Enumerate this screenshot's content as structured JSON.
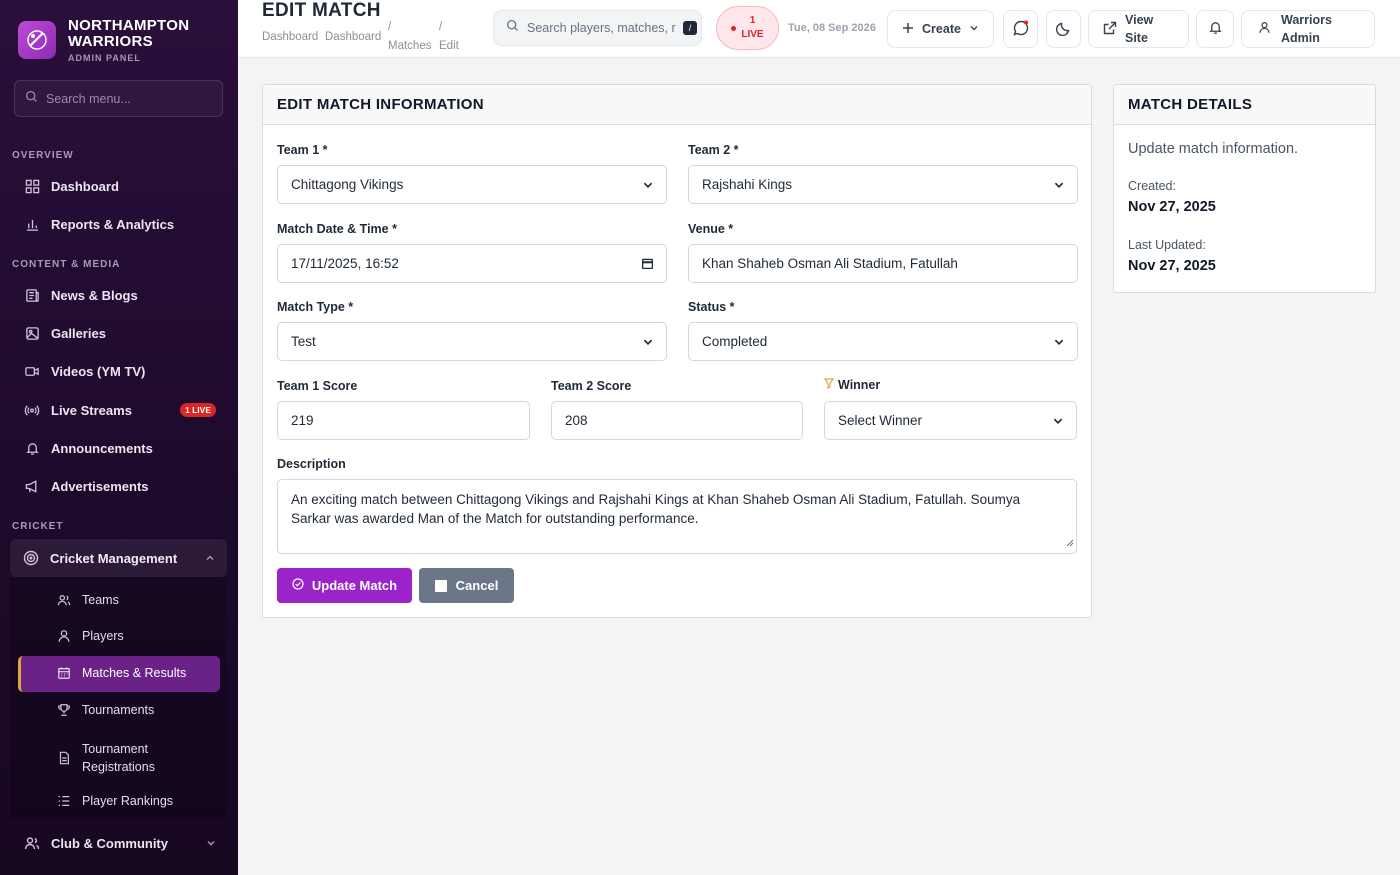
{
  "brand": {
    "name_line1": "NORTHAMPTON",
    "name_line2": "WARRIORS",
    "subtitle": "ADMIN PANEL"
  },
  "sidebar": {
    "search_placeholder": "Search menu...",
    "sections": {
      "overview": "OVERVIEW",
      "content": "CONTENT & MEDIA",
      "cricket": "CRICKET"
    },
    "items": {
      "dashboard": "Dashboard",
      "reports": "Reports & Analytics",
      "news": "News & Blogs",
      "galleries": "Galleries",
      "videos": "Videos (YM TV)",
      "live_streams": "Live Streams",
      "live_badge": "1 LIVE",
      "announcements": "Announcements",
      "advertisements": "Advertisements",
      "cricket_management": "Cricket Management",
      "club_community": "Club & Community"
    },
    "sub_items": {
      "teams": "Teams",
      "players": "Players",
      "matches": "Matches & Results",
      "tournaments": "Tournaments",
      "registrations_line1": "Tournament",
      "registrations_line2": "Registrations",
      "rankings": "Player Rankings"
    }
  },
  "header": {
    "title": "EDIT MATCH",
    "breadcrumb": [
      "Dashboard",
      "Dashboard",
      "/",
      "Matches",
      "/",
      "Edit"
    ],
    "search_placeholder": "Search players, matches, r",
    "search_shortcut": "/",
    "live_count": "1",
    "live_label": "LIVE",
    "date": "Tue, 08 Sep 2026",
    "create_label": "Create",
    "view_site_line1": "View",
    "view_site_line2": "Site",
    "user_line1": "Warriors",
    "user_line2": "Admin"
  },
  "form": {
    "heading": "EDIT MATCH INFORMATION",
    "team1_label": "Team 1 *",
    "team1_value": "Chittagong Vikings",
    "team2_label": "Team 2 *",
    "team2_value": "Rajshahi Kings",
    "datetime_label": "Match Date & Time *",
    "datetime_value": "17/11/2025, 16:52",
    "venue_label": "Venue *",
    "venue_value": "Khan Shaheb Osman Ali Stadium, Fatullah",
    "type_label": "Match Type *",
    "type_value": "Test",
    "status_label": "Status *",
    "status_value": "Completed",
    "score1_label": "Team 1 Score",
    "score1_value": "219",
    "score2_label": "Team 2 Score",
    "score2_value": "208",
    "winner_label": "Winner",
    "winner_value": "Select Winner",
    "description_label": "Description",
    "description_value": "An exciting match between Chittagong Vikings and Rajshahi Kings at Khan Shaheb Osman Ali Stadium, Fatullah. Soumya Sarkar was awarded Man of the Match for outstanding performance.",
    "update_label": "Update Match",
    "cancel_label": "Cancel"
  },
  "details": {
    "heading": "MATCH DETAILS",
    "intro": "Update match information.",
    "created_label": "Created:",
    "created_value": "Nov 27, 2025",
    "updated_label": "Last Updated:",
    "updated_value": "Nov 27, 2025"
  },
  "colors": {
    "accent": "#9b23c9",
    "sidebar": "#2a0f3a",
    "live": "#dc2626",
    "trophy": "#e0a83a"
  }
}
